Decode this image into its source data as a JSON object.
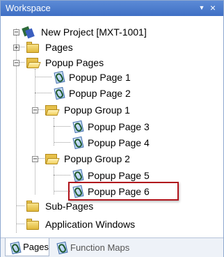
{
  "panel": {
    "title": "Workspace",
    "dropdown_glyph": "▼",
    "close_glyph": "×"
  },
  "tree": {
    "project": "New Project [MXT-1001]",
    "pages": "Pages",
    "popup_pages": "Popup Pages",
    "popup_page_1": "Popup Page 1",
    "popup_page_2": "Popup Page 2",
    "popup_group_1": "Popup Group 1",
    "popup_page_3": "Popup Page 3",
    "popup_page_4": "Popup Page 4",
    "popup_group_2": "Popup Group 2",
    "popup_page_5": "Popup Page 5",
    "popup_page_6": "Popup Page 6",
    "sub_pages": "Sub-Pages",
    "application_windows": "Application Windows",
    "expander_minus": "−",
    "expander_plus": "+"
  },
  "tabs": {
    "pages": "Pages",
    "function_maps": "Function Maps"
  },
  "colors": {
    "title_bar": "#4a7bcf",
    "selection_outline": "#b0141c"
  },
  "icons": {
    "project": "project-icon",
    "folder_open": "folder-open-icon",
    "folder_closed": "folder-closed-icon",
    "page": "popup-page-icon"
  }
}
